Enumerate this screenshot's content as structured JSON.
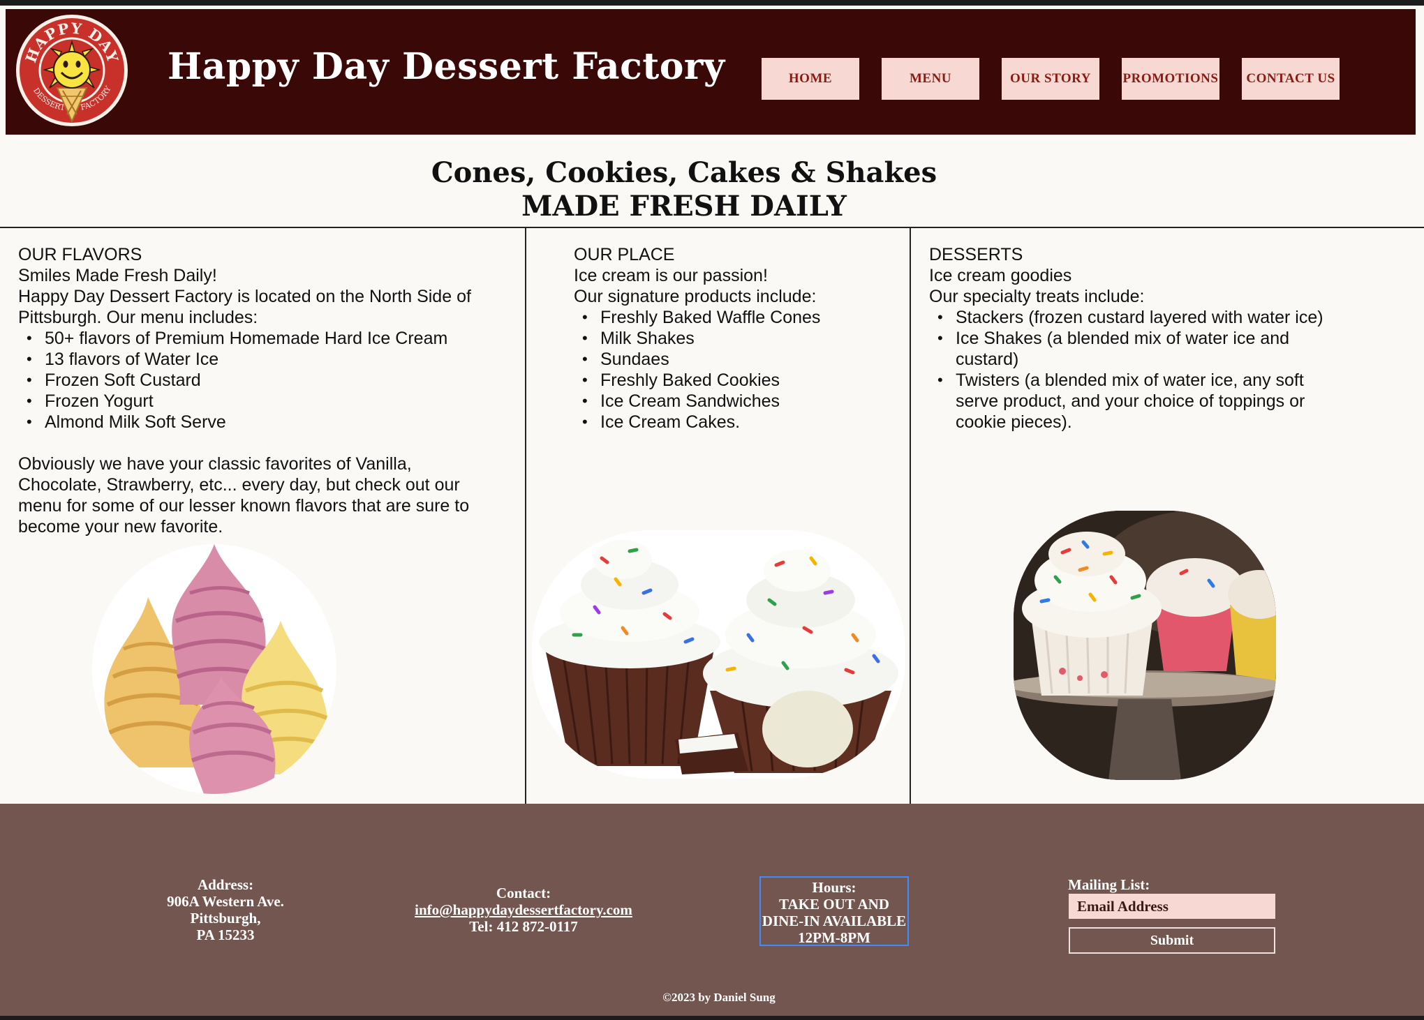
{
  "header": {
    "logo": {
      "top_text": "HAPPY DAY",
      "bottom_left_text": "DESSERT",
      "bottom_right_text": "FACTORY"
    },
    "title": "Happy Day Dessert Factory",
    "nav": [
      "HOME",
      "MENU",
      "OUR STORY",
      "PROMOTIONS",
      "CONTACT US"
    ]
  },
  "hero": {
    "line1": "Cones, Cookies, Cakes & Shakes",
    "line2": "MADE FRESH DAILY"
  },
  "columns": {
    "flavors": {
      "heading": "OUR FLAVORS",
      "tagline": "Smiles Made Fresh Daily!",
      "intro": "Happy Day Dessert Factory is located on the North Side of Pittsburgh. Our menu includes:",
      "items": [
        "50+ flavors of Premium Homemade Hard Ice Cream",
        "13 flavors of Water Ice",
        "Frozen Soft Custard",
        "Frozen Yogurt",
        "Almond Milk Soft Serve"
      ],
      "outro": "Obviously we have your classic favorites of Vanilla, Chocolate, Strawberry, etc... every day, but check out our menu for some of our lesser known flavors that are sure to become your new favorite."
    },
    "place": {
      "heading": "OUR PLACE",
      "tagline": "Ice cream is our passion!",
      "intro": "Our signature products include:",
      "items": [
        "Freshly Baked Waffle Cones",
        "Milk Shakes",
        "Sundaes",
        "Freshly Baked Cookies",
        "Ice Cream Sandwiches",
        "Ice Cream Cakes."
      ]
    },
    "desserts": {
      "heading": "DESSERTS",
      "tagline": "Ice cream goodies",
      "intro": "Our specialty treats include:",
      "items": [
        "Stackers (frozen custard layered with water ice)",
        "Ice Shakes (a blended mix of water ice and custard)",
        "Twisters (a blended mix of water ice, any soft serve product, and your choice of toppings or cookie pieces)."
      ]
    }
  },
  "footer": {
    "address": {
      "label": "Address:",
      "line1": "906A Western Ave.",
      "line2": "Pittsburgh,",
      "line3": "PA 15233"
    },
    "contact": {
      "label": "Contact:",
      "email": "info@happydaydessertfactory.com",
      "phone": "Tel: 412 872-0117"
    },
    "hours": {
      "label": "Hours:",
      "line1": "TAKE OUT AND",
      "line2": "DINE-IN AVAILABLE",
      "line3": "12PM-8PM"
    },
    "mailing": {
      "label": "Mailing List:",
      "placeholder": "Email Address",
      "submit": "Submit"
    },
    "copyright": "©2023 by Daniel Sung"
  },
  "colors": {
    "header_bg": "#3a0806",
    "nav_button_bg": "#f7d8d2",
    "nav_button_text": "#8b1a12",
    "page_bg": "#faf9f6",
    "footer_bg": "#735650",
    "hours_border": "#3f8bff"
  },
  "icons": {
    "logo": "smiley-ice-cream-cone-badge",
    "images": [
      "soft-serve-swirls-image",
      "sprinkle-cupcakes-image",
      "cupcakes-on-stand-image"
    ]
  }
}
